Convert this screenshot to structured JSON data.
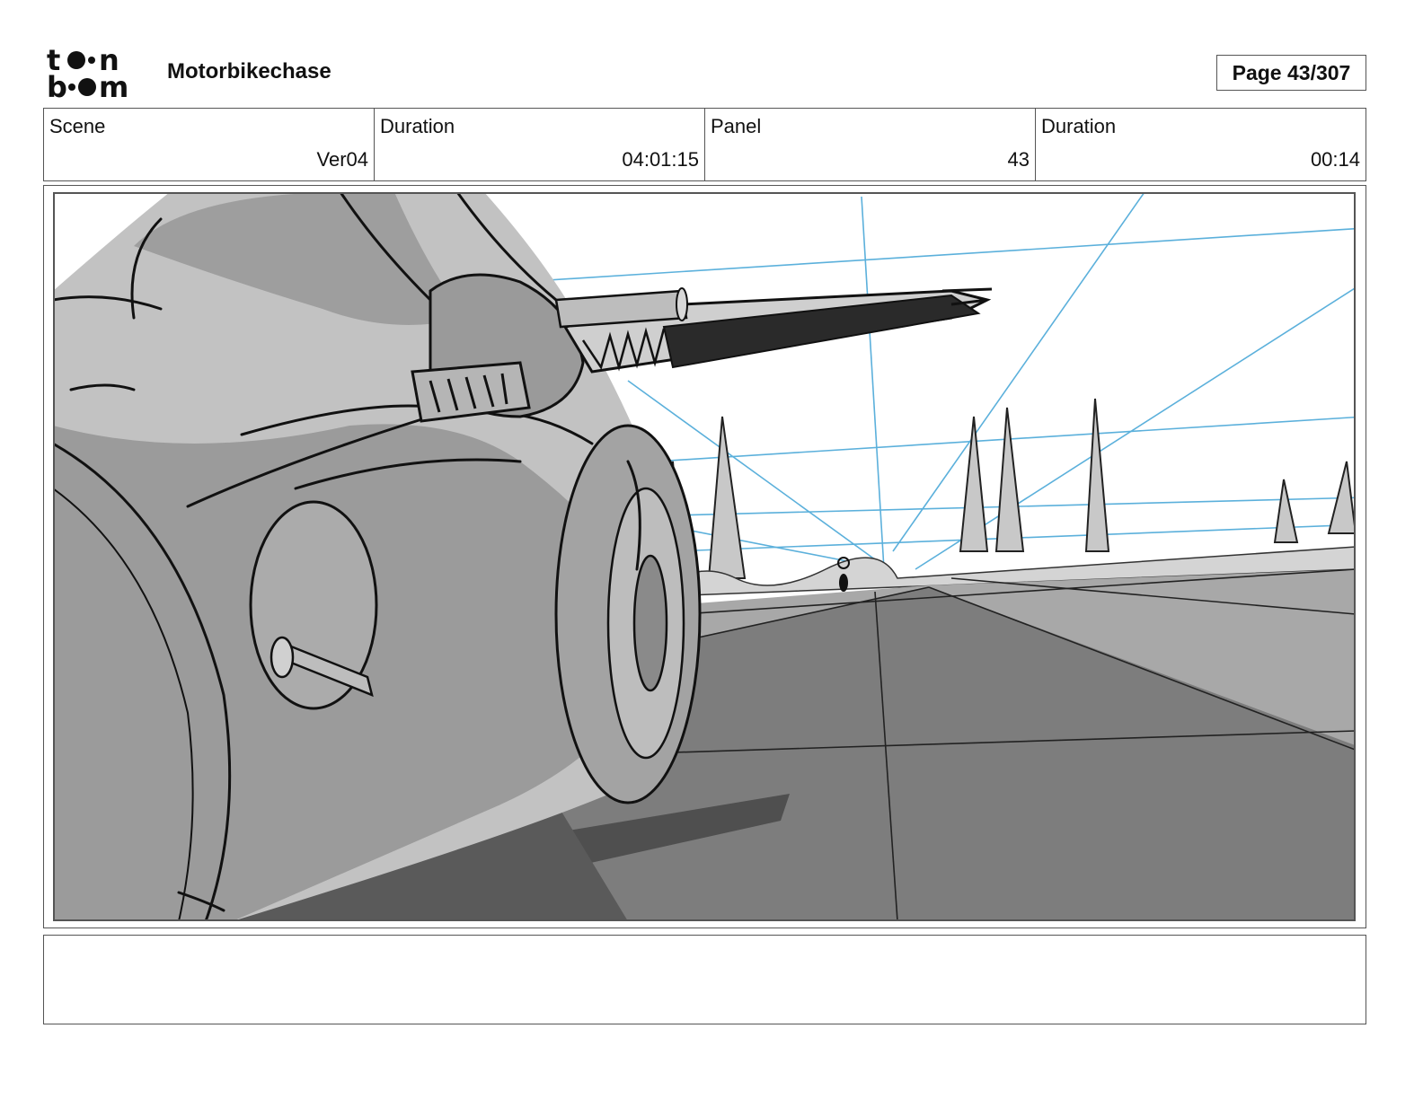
{
  "header": {
    "logo_text": "toonboom",
    "project_title": "Motorbikechase",
    "page_label": "Page",
    "page_value": "43/307"
  },
  "info": [
    {
      "label": "Scene",
      "value": "Ver04"
    },
    {
      "label": "Duration",
      "value": "04:01:15"
    },
    {
      "label": "Panel",
      "value": "43"
    },
    {
      "label": "Duration",
      "value": "00:14"
    }
  ],
  "panel": {
    "description": "",
    "colors": {
      "sky": "#ffffff",
      "road": "#7a7a7a",
      "roadside": "#a9a9a9",
      "car_light": "#c4c4c4",
      "car_mid": "#9a9a9a",
      "shadow": "#555555",
      "guides": "#4aa8d8",
      "ink": "#111111"
    }
  },
  "notes": {
    "text": ""
  }
}
